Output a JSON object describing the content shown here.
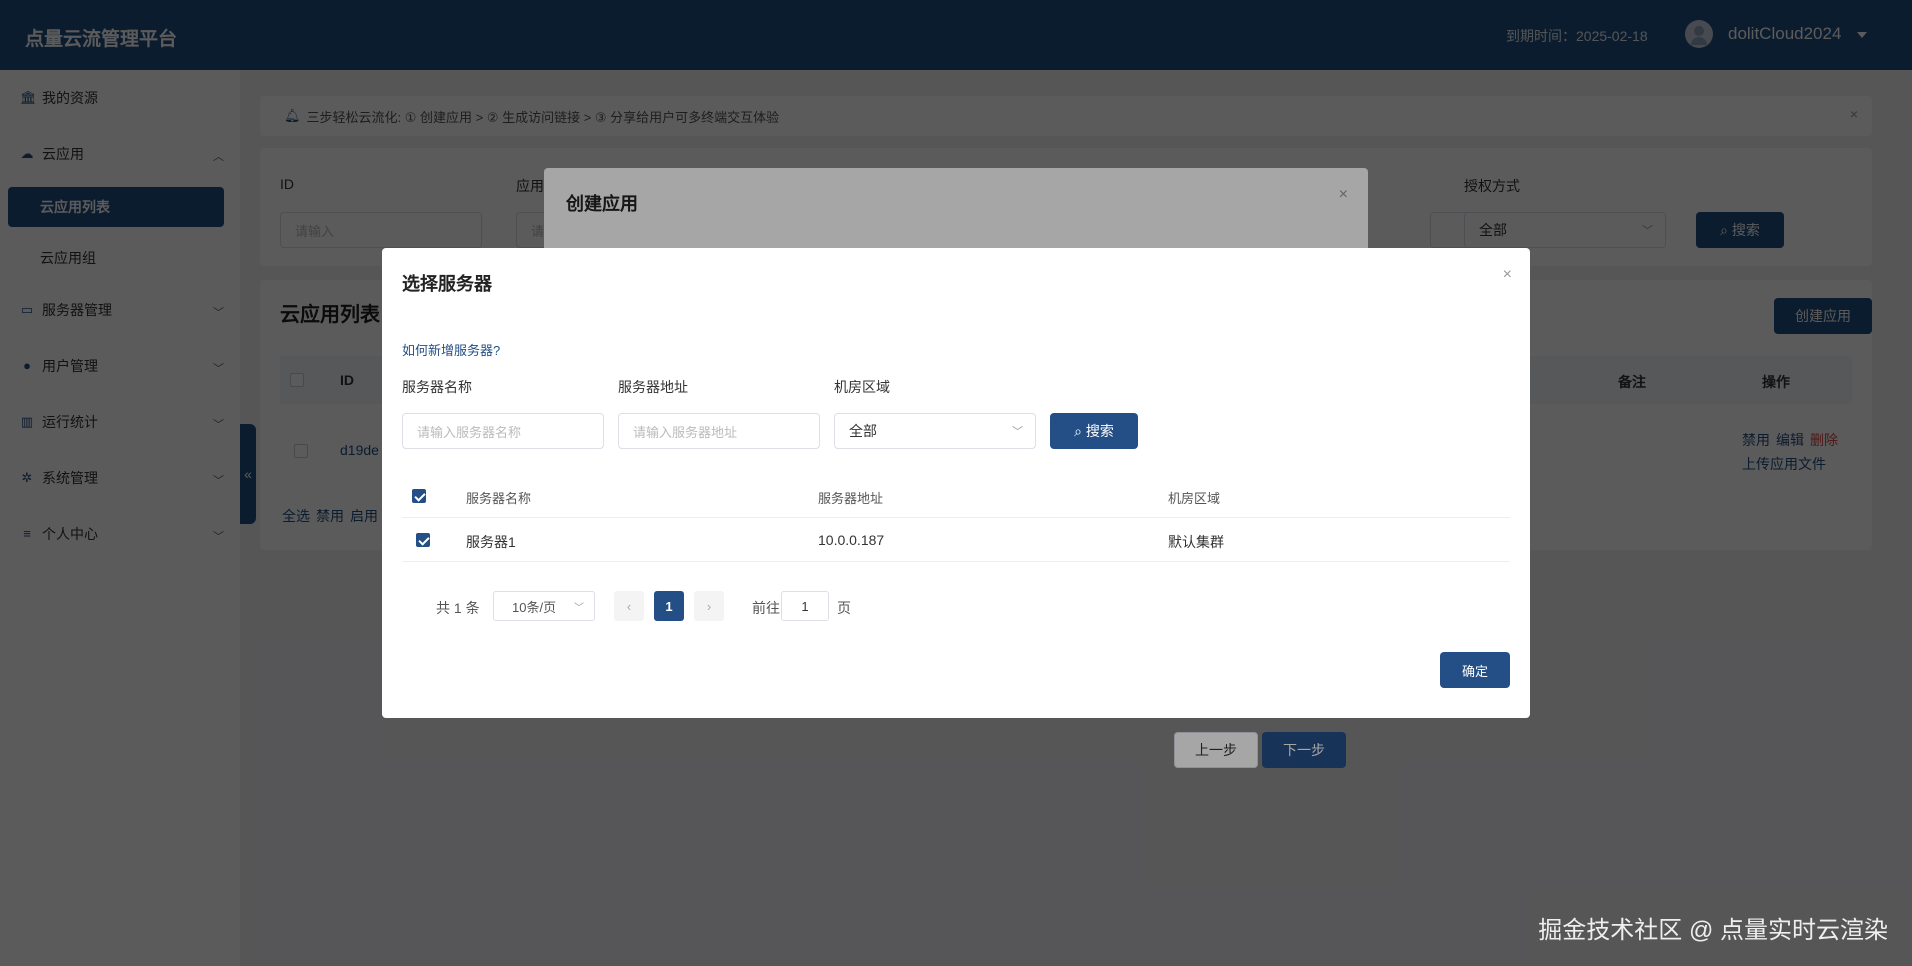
{
  "header": {
    "brand": "点量云流管理平台",
    "expire": "到期时间：2025-02-18",
    "username": "dolitCloud2024"
  },
  "sidebar": {
    "items": [
      {
        "label": "我的资源",
        "icon": "bank-icon"
      },
      {
        "label": "云应用",
        "icon": "cloud-icon"
      },
      {
        "label": "云应用列表"
      },
      {
        "label": "云应用组"
      },
      {
        "label": "服务器管理",
        "icon": "monitor-icon"
      },
      {
        "label": "用户管理",
        "icon": "user-icon"
      },
      {
        "label": "运行统计",
        "icon": "chart-icon"
      },
      {
        "label": "系统管理",
        "icon": "gear-icon"
      },
      {
        "label": "个人中心",
        "icon": "database-icon"
      }
    ],
    "collapse": "«"
  },
  "banner": {
    "text": "三步轻松云流化:  ① 创建应用 > ② 生成访问链接 > ③ 分享给用户可多终端交互体验",
    "close": "×"
  },
  "filter": {
    "id_label": "ID",
    "id_placeholder": "请输入",
    "app_label": "应用",
    "app_placeholder": "请",
    "auth_label": "授权方式",
    "auth_value": "全部",
    "search_btn": "搜索"
  },
  "list": {
    "title": "云应用列表",
    "create_btn": "创建应用",
    "col_id": "ID",
    "col_note": "备注",
    "col_ops": "操作",
    "row_id": "d19de",
    "op_disable": "禁用",
    "op_edit": "编辑",
    "op_delete": "删除",
    "op_upload": "上传应用文件",
    "bulk_select_all": "全选",
    "bulk_disable": "禁用",
    "bulk_enable": "启用"
  },
  "create_dialog": {
    "title": "创建应用",
    "close": "×",
    "prev_btn": "上一步",
    "next_btn": "下一步"
  },
  "server_dialog": {
    "title": "选择服务器",
    "close": "×",
    "help_link": "如何新增服务器?",
    "name_label": "服务器名称",
    "name_placeholder": "请输入服务器名称",
    "addr_label": "服务器地址",
    "addr_placeholder": "请输入服务器地址",
    "region_label": "机房区域",
    "region_value": "全部",
    "search_btn": "搜索",
    "columns": [
      "服务器名称",
      "服务器地址",
      "机房区域"
    ],
    "rows": [
      {
        "name": "服务器1",
        "address": "10.0.0.187",
        "region": "默认集群",
        "checked": true
      }
    ],
    "pager": {
      "total": "共 1 条",
      "size": "10条/页",
      "current_page": "1",
      "goto_label": "前往",
      "goto_value": "1",
      "goto_unit": "页"
    },
    "confirm_btn": "确定"
  },
  "watermark": "掘金技术社区 @ 点量实时云渲染",
  "colors": {
    "primary": "#244f86",
    "danger": "#e04545"
  }
}
